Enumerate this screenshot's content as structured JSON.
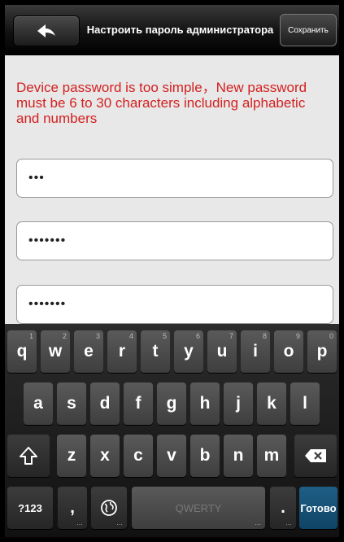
{
  "header": {
    "title": "Настроить пароль администратора",
    "save_label": "Сохранить",
    "back_icon": "arrow-left-icon"
  },
  "content": {
    "warning": "Device password is too simple，New password must be 6 to 30 characters including alphabetic and numbers",
    "fields": [
      {
        "value": "•••"
      },
      {
        "value": "•••••••"
      },
      {
        "value": "•••••••"
      }
    ]
  },
  "keyboard": {
    "row1": [
      {
        "label": "q",
        "hint": "1"
      },
      {
        "label": "w",
        "hint": "2"
      },
      {
        "label": "e",
        "hint": "3"
      },
      {
        "label": "r",
        "hint": "4"
      },
      {
        "label": "t",
        "hint": "5"
      },
      {
        "label": "y",
        "hint": "6"
      },
      {
        "label": "u",
        "hint": "7"
      },
      {
        "label": "i",
        "hint": "8"
      },
      {
        "label": "o",
        "hint": "9"
      },
      {
        "label": "p",
        "hint": "0"
      }
    ],
    "row2": [
      "a",
      "s",
      "d",
      "f",
      "g",
      "h",
      "j",
      "k",
      "l"
    ],
    "row3": [
      "z",
      "x",
      "c",
      "v",
      "b",
      "n",
      "m"
    ],
    "symbols_label": "?123",
    "comma_label": ",",
    "space_label": "QWERTY",
    "period_label": ".",
    "done_label": "Готово",
    "accent_color": "#1f5f86"
  }
}
